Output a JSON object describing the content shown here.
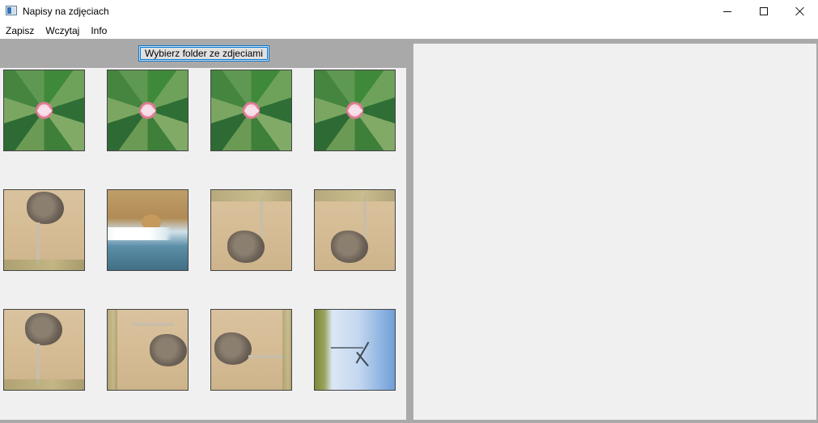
{
  "window": {
    "title": "Napisy na zdjęciach"
  },
  "menu": [
    {
      "label": "Zapisz"
    },
    {
      "label": "Wczytaj"
    },
    {
      "label": "Info"
    }
  ],
  "toolbar": {
    "choose_folder_label": "Wybierz folder ze zdjeciami"
  },
  "thumbnails": [
    {
      "icon": "plumeria-flower-image"
    },
    {
      "icon": "plumeria-flower-image"
    },
    {
      "icon": "plumeria-flower-image"
    },
    {
      "icon": "plumeria-flower-image"
    },
    {
      "icon": "ostrich-image"
    },
    {
      "icon": "lion-water-image"
    },
    {
      "icon": "ostrich-image"
    },
    {
      "icon": "ostrich-image"
    },
    {
      "icon": "ostrich-image"
    },
    {
      "icon": "ostrich-image"
    },
    {
      "icon": "ostrich-image"
    },
    {
      "icon": "wind-turbine-image"
    }
  ],
  "colors": {
    "panel_background": "#f0f0f0",
    "frame_gray": "#a9a9a9",
    "accent_border": "#0078d7",
    "button_face": "#e1e1e1"
  }
}
